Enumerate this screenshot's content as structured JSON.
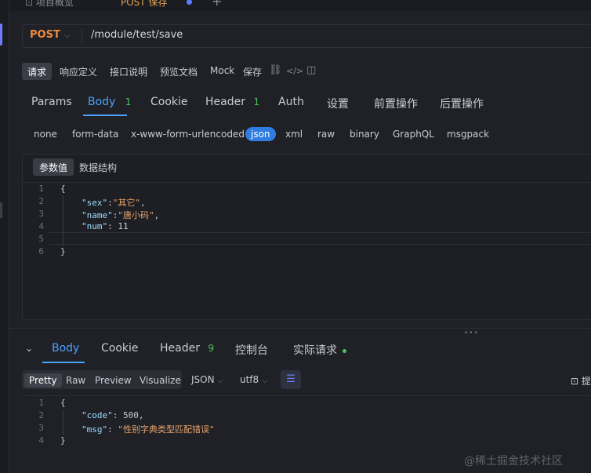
{
  "tabs": [
    {
      "label": "项目概览"
    },
    {
      "label": "POST 保存"
    }
  ],
  "tab_new_symbol": "+",
  "tab_more_symbol": "···",
  "request": {
    "method": "POST",
    "url": "/module/test/save"
  },
  "subtoolbar": {
    "items": [
      "请求",
      "响应定义",
      "接口说明",
      "预览文档",
      "Mock",
      "保存"
    ]
  },
  "param_tabs": [
    {
      "label": "Params"
    },
    {
      "label": "Body",
      "count": "1"
    },
    {
      "label": "Cookie"
    },
    {
      "label": "Header",
      "count": "1"
    },
    {
      "label": "Auth"
    },
    {
      "label": "设置"
    },
    {
      "label": "前置操作"
    },
    {
      "label": "后置操作"
    }
  ],
  "body_types": [
    "none",
    "form-data",
    "x-www-form-urlencoded",
    "json",
    "xml",
    "raw",
    "binary",
    "GraphQL",
    "msgpack"
  ],
  "editor": {
    "tabs": [
      "参数值",
      "数据结构"
    ],
    "line_numbers": [
      "1",
      "2",
      "3",
      "4",
      "5",
      "6"
    ],
    "lines": {
      "l1": "{",
      "l2_key": "\"sex\"",
      "l2_colon": ":",
      "l2_val": "\"其它\"",
      "l2_tail": ",",
      "l3_key": "\"name\"",
      "l3_colon": ":",
      "l3_val": "\"唐小码\"",
      "l3_tail": ",",
      "l4_key": "\"num\"",
      "l4_colon": ": ",
      "l4_val": "11",
      "l6": "}"
    }
  },
  "response": {
    "tabs": [
      {
        "label": "Body"
      },
      {
        "label": "Cookie"
      },
      {
        "label": "Header",
        "count": "9"
      },
      {
        "label": "控制台"
      },
      {
        "label": "实际请求"
      }
    ],
    "view_modes": [
      "Pretty",
      "Raw",
      "Preview",
      "Visualize"
    ],
    "format": "JSON",
    "encoding": "utf8",
    "right_label": "提",
    "line_numbers": [
      "1",
      "2",
      "3",
      "4"
    ],
    "lines": {
      "l1": "{",
      "l2_key": "\"code\"",
      "l2_colon": ": ",
      "l2_val": "500",
      "l2_tail": ",",
      "l3_key": "\"msg\"",
      "l3_colon": ": ",
      "l3_val": "\"性别字典类型匹配错误\"",
      "l4": "}"
    }
  },
  "watermark": "@稀土掘金技术社区",
  "colors": {
    "accent_blue": "#4aa3ff",
    "method_orange": "#f08a3c",
    "count_green": "#4cc35a",
    "json_pill": "#2f7de1"
  }
}
